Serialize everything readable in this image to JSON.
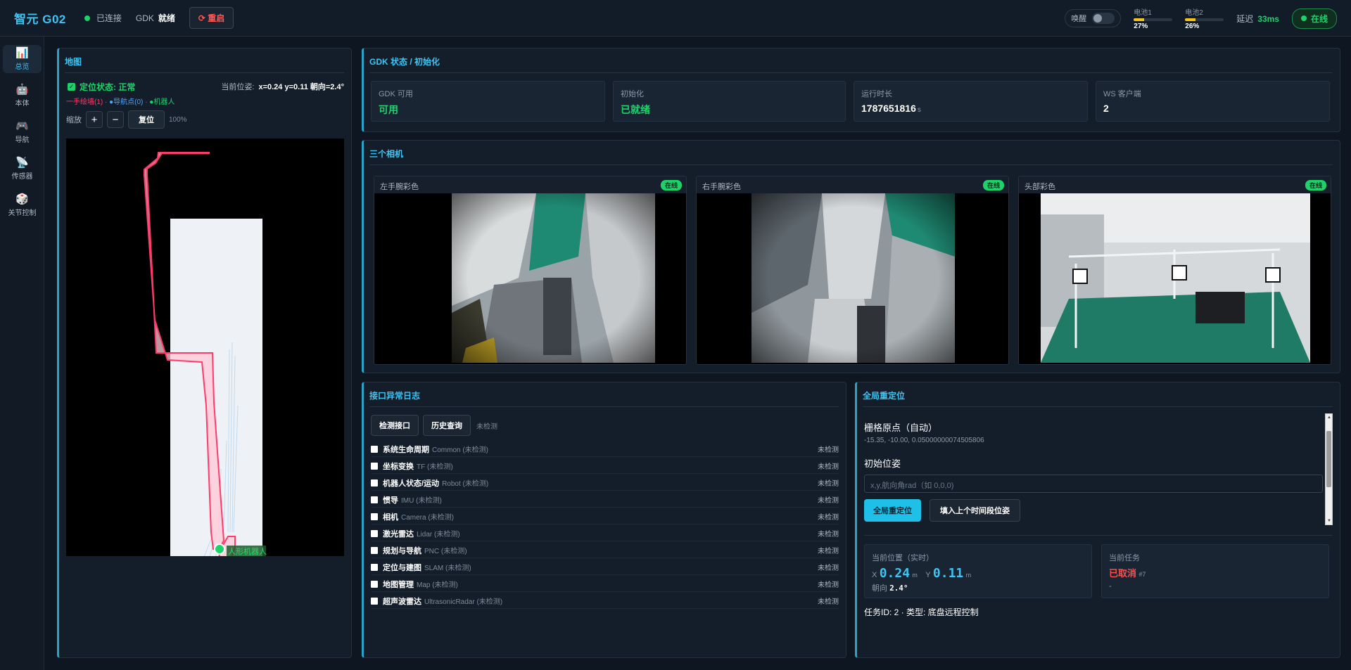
{
  "header": {
    "brand": "智元 G02",
    "connection": "已连接",
    "gdk_label": "GDK",
    "gdk_status": "就绪",
    "restart_label": "⟳ 重启",
    "wake_label": "唤醒",
    "battery1": {
      "label": "电池1",
      "percent": "27%",
      "level": 0.27
    },
    "battery2": {
      "label": "电池2",
      "percent": "26%",
      "level": 0.26
    },
    "latency_label": "延迟",
    "latency_value": "33ms",
    "online_label": "在线"
  },
  "sidebar": {
    "items": [
      {
        "label": "总览",
        "icon": "chart-icon",
        "glyph": "📊",
        "active": true
      },
      {
        "label": "本体",
        "icon": "robot-icon",
        "glyph": "🤖",
        "active": false
      },
      {
        "label": "导航",
        "icon": "gamepad-icon",
        "glyph": "🎮",
        "active": false
      },
      {
        "label": "传感器",
        "icon": "satellite-icon",
        "glyph": "📡",
        "active": false
      },
      {
        "label": "关节控制",
        "icon": "dice-icon",
        "glyph": "🎲",
        "active": false
      }
    ]
  },
  "map": {
    "title": "地图",
    "status": "定位状态: 正常",
    "pose_label": "当前位姿:",
    "pose_value": "x=0.24 y=0.11 朝向=2.4°",
    "legend_wall": "一手绘墙(1)",
    "legend_nav": "●导航点(0)",
    "legend_robot": "●机器人",
    "legend_sep": " · ",
    "zoom_label": "缩放",
    "zoom_in": "+",
    "zoom_out": "−",
    "reset": "复位",
    "zoom_value": "100%",
    "robot_label": "人形机器人"
  },
  "gdk": {
    "title": "GDK 状态 / 初始化",
    "stats": [
      {
        "label": "GDK 可用",
        "value": "可用",
        "unit": "",
        "green": true
      },
      {
        "label": "初始化",
        "value": "已就绪",
        "unit": "",
        "green": true
      },
      {
        "label": "运行时长",
        "value": "1787651816",
        "unit": "s",
        "green": false
      },
      {
        "label": "WS 客户端",
        "value": "2",
        "unit": "",
        "green": false
      }
    ]
  },
  "cameras": {
    "title": "三个相机",
    "items": [
      {
        "label": "左手腕彩色",
        "status": "在线"
      },
      {
        "label": "右手腕彩色",
        "status": "在线"
      },
      {
        "label": "头部彩色",
        "status": "在线"
      }
    ]
  },
  "log": {
    "title": "接口异常日志",
    "detect_button": "检测接口",
    "history_button": "历史查询",
    "status": "未检测",
    "rows": [
      {
        "name": "系统生命周期",
        "eng": "Common (未检测)",
        "status": "未检测"
      },
      {
        "name": "坐标变换",
        "eng": "TF (未检测)",
        "status": "未检测"
      },
      {
        "name": "机器人状态/运动",
        "eng": "Robot (未检测)",
        "status": "未检测"
      },
      {
        "name": "惯导",
        "eng": "IMU (未检测)",
        "status": "未检测"
      },
      {
        "name": "相机",
        "eng": "Camera (未检测)",
        "status": "未检测"
      },
      {
        "name": "激光雷达",
        "eng": "Lidar (未检测)",
        "status": "未检测"
      },
      {
        "name": "规划与导航",
        "eng": "PNC (未检测)",
        "status": "未检测"
      },
      {
        "name": "定位与建图",
        "eng": "SLAM (未检测)",
        "status": "未检测"
      },
      {
        "name": "地图管理",
        "eng": "Map (未检测)",
        "status": "未检测"
      },
      {
        "name": "超声波雷达",
        "eng": "UltrasonicRadar (未检测)",
        "status": "未检测"
      }
    ]
  },
  "reloc": {
    "title": "全局重定位",
    "grid_origin_label": "栅格原点（自动）",
    "grid_origin_value": "-15.35, -10.00, 0.05000000074505806",
    "init_pose_label": "初始位姿",
    "init_pose_placeholder": "x,y,航向角rad（如 0,0,0)",
    "relocate_button": "全局重定位",
    "fill_button": "填入上个时间段位姿",
    "current_pos_label": "当前位置（实时）",
    "x_label": "X",
    "x_value": "0.24",
    "y_label": "Y",
    "y_value": "0.11",
    "unit": "m",
    "heading_label": "朝向",
    "heading_value": "2.4°",
    "task_label": "当前任务",
    "task_status": "已取消",
    "task_num": "#7",
    "task_dash": "-",
    "task_info": "任务ID: 2 · 类型: 底盘远程控制"
  },
  "colors": {
    "accent": "#3fc3f3",
    "ok": "#1ed26a",
    "danger": "#ff4d4d",
    "wall": "#ff3b6b"
  }
}
